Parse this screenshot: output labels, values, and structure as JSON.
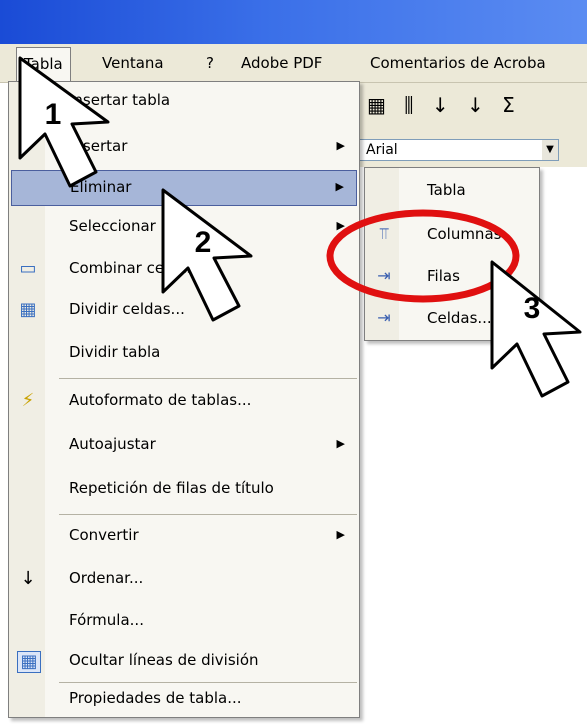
{
  "menubar": {
    "items": [
      {
        "label": "Tabla",
        "open": true
      },
      {
        "label": "Ventana"
      },
      {
        "label": "?"
      },
      {
        "label": "Adobe PDF"
      },
      {
        "label": "Comentarios de Acroba"
      }
    ]
  },
  "toolbar": {
    "icons": [
      "table-icon",
      "columns-icon",
      "sort-ascending-icon",
      "sort-descending-icon",
      "sigma-icon"
    ],
    "font_value": "Arial"
  },
  "menu": {
    "items": [
      {
        "label": "Insertar tabla",
        "icon": "insert-table-icon"
      },
      {
        "label": "Insertar",
        "submenu": true
      },
      {
        "label": "Eliminar",
        "submenu": true,
        "highlighted": true
      },
      {
        "label": "Seleccionar",
        "submenu": true
      },
      {
        "label": "Combinar celdas",
        "icon": "merge-cells-icon"
      },
      {
        "label": "Dividir celdas...",
        "icon": "split-cells-icon"
      },
      {
        "label": "Dividir tabla"
      },
      {
        "label": "Autoformato de tablas...",
        "icon": "autoformat-icon"
      },
      {
        "label": "Autoajustar",
        "submenu": true
      },
      {
        "label": "Repetición de filas de título"
      },
      {
        "label": "Convertir",
        "submenu": true
      },
      {
        "label": "Ordenar...",
        "icon": "sort-az-icon"
      },
      {
        "label": "Fórmula..."
      },
      {
        "label": "Ocultar líneas de división",
        "icon": "gridlines-icon"
      },
      {
        "label": "Propiedades de tabla..."
      }
    ]
  },
  "submenu": {
    "items": [
      {
        "label": "Tabla"
      },
      {
        "label": "Columnas",
        "icon": "delete-columns-icon"
      },
      {
        "label": "Filas",
        "icon": "delete-rows-icon"
      },
      {
        "label": "Celdas...",
        "icon": "delete-cells-icon"
      }
    ]
  },
  "callouts": [
    "1",
    "2",
    "3"
  ],
  "colors": {
    "title_bar": "#3a6fe8",
    "menu_bg": "#f8f7f2",
    "highlight": "#a6b6d8",
    "circle": "#e01010"
  }
}
